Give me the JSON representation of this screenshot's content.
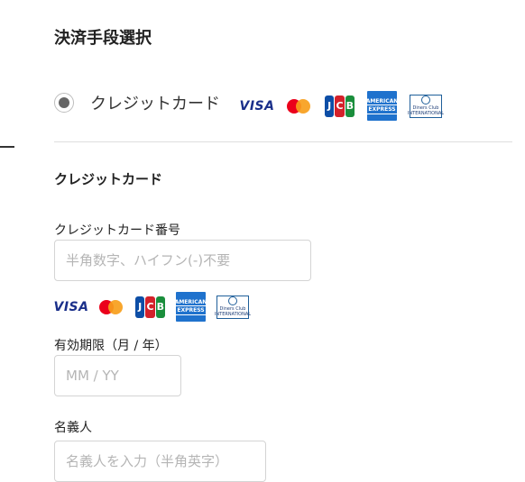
{
  "page": {
    "title": "決済手段選択"
  },
  "payment_option": {
    "label": "クレジットカード",
    "selected": true
  },
  "brands": {
    "visa": "VISA",
    "jcb": [
      "J",
      "C",
      "B"
    ],
    "amex_top": "AMERICAN",
    "amex_bottom": "EXPRESS",
    "diners_top": "Diners Club",
    "diners_bottom": "INTERNATIONAL"
  },
  "card_form": {
    "section_title": "クレジットカード",
    "number_label": "クレジットカード番号",
    "number_placeholder": "半角数字、ハイフン(-)不要",
    "expiry_label": "有効期限（月 / 年）",
    "expiry_placeholder": "MM / YY",
    "holder_label": "名義人",
    "holder_placeholder": "名義人を入力（半角英字）"
  }
}
